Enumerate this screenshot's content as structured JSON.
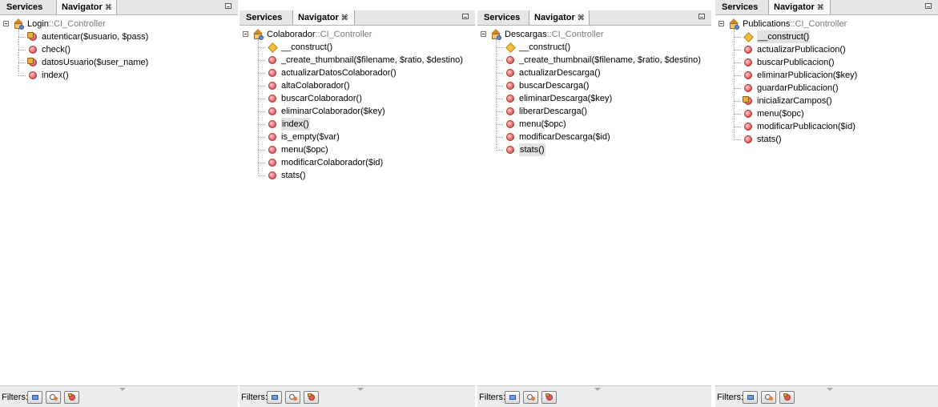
{
  "panels": [
    {
      "tab_services": "Services",
      "tab_navigator": "Navigator",
      "tab_close": "⌘",
      "class_name": "Login",
      "class_parent": "::CI_Controller",
      "filters_label": "Filters:",
      "members": [
        {
          "label": "autenticar($usuario, $pass)",
          "icon": "protected-method-icon"
        },
        {
          "label": "check()",
          "icon": "method-icon"
        },
        {
          "label": "datosUsuario($user_name)",
          "icon": "protected-method-icon"
        },
        {
          "label": "index()",
          "icon": "method-icon"
        }
      ]
    },
    {
      "tab_services": "Services",
      "tab_navigator": "Navigator",
      "tab_close": "⌘",
      "class_name": "Colaborador",
      "class_parent": "::CI_Controller",
      "filters_label": "Filters:",
      "members": [
        {
          "label": "__construct()",
          "icon": "constructor-icon"
        },
        {
          "label": "_create_thumbnail($filename, $ratio, $destino)",
          "icon": "method-icon"
        },
        {
          "label": "actualizarDatosColaborador()",
          "icon": "method-icon"
        },
        {
          "label": "altaColaborador()",
          "icon": "method-icon"
        },
        {
          "label": "buscarColaborador()",
          "icon": "method-icon"
        },
        {
          "label": "eliminarColaborador($key)",
          "icon": "method-icon"
        },
        {
          "label": "index()",
          "icon": "method-icon",
          "selected": true
        },
        {
          "label": "is_empty($var)",
          "icon": "method-icon"
        },
        {
          "label": "menu($opc)",
          "icon": "method-icon"
        },
        {
          "label": "modificarColaborador($id)",
          "icon": "method-icon"
        },
        {
          "label": "stats()",
          "icon": "method-icon"
        }
      ]
    },
    {
      "tab_services": "Services",
      "tab_navigator": "Navigator",
      "tab_close": "⌘",
      "class_name": "Descargas",
      "class_parent": "::CI_Controller",
      "filters_label": "Filters:",
      "members": [
        {
          "label": "__construct()",
          "icon": "constructor-icon"
        },
        {
          "label": "_create_thumbnail($filename, $ratio, $destino)",
          "icon": "method-icon"
        },
        {
          "label": "actualizarDescarga()",
          "icon": "method-icon"
        },
        {
          "label": "buscarDescarga()",
          "icon": "method-icon"
        },
        {
          "label": "eliminarDescarga($key)",
          "icon": "method-icon"
        },
        {
          "label": "liberarDescarga()",
          "icon": "method-icon"
        },
        {
          "label": "menu($opc)",
          "icon": "method-icon"
        },
        {
          "label": "modificarDescarga($id)",
          "icon": "method-icon"
        },
        {
          "label": "stats()",
          "icon": "method-icon",
          "selected": true
        }
      ]
    },
    {
      "tab_services": "Services",
      "tab_navigator": "Navigator",
      "tab_close": "⌘",
      "class_name": "Publications",
      "class_parent": "::CI_Controller",
      "filters_label": "Filters:",
      "members": [
        {
          "label": "__construct()",
          "icon": "constructor-icon",
          "selected": true
        },
        {
          "label": "actualizarPublicacion()",
          "icon": "method-icon"
        },
        {
          "label": "buscarPublicacion()",
          "icon": "method-icon"
        },
        {
          "label": "eliminarPublicacion($key)",
          "icon": "method-icon"
        },
        {
          "label": "guardarPublicacion()",
          "icon": "method-icon"
        },
        {
          "label": "inicializarCampos()",
          "icon": "protected-method-icon"
        },
        {
          "label": "menu($opc)",
          "icon": "method-icon"
        },
        {
          "label": "modificarPublicacion($id)",
          "icon": "method-icon"
        },
        {
          "label": "stats()",
          "icon": "method-icon"
        }
      ]
    }
  ]
}
